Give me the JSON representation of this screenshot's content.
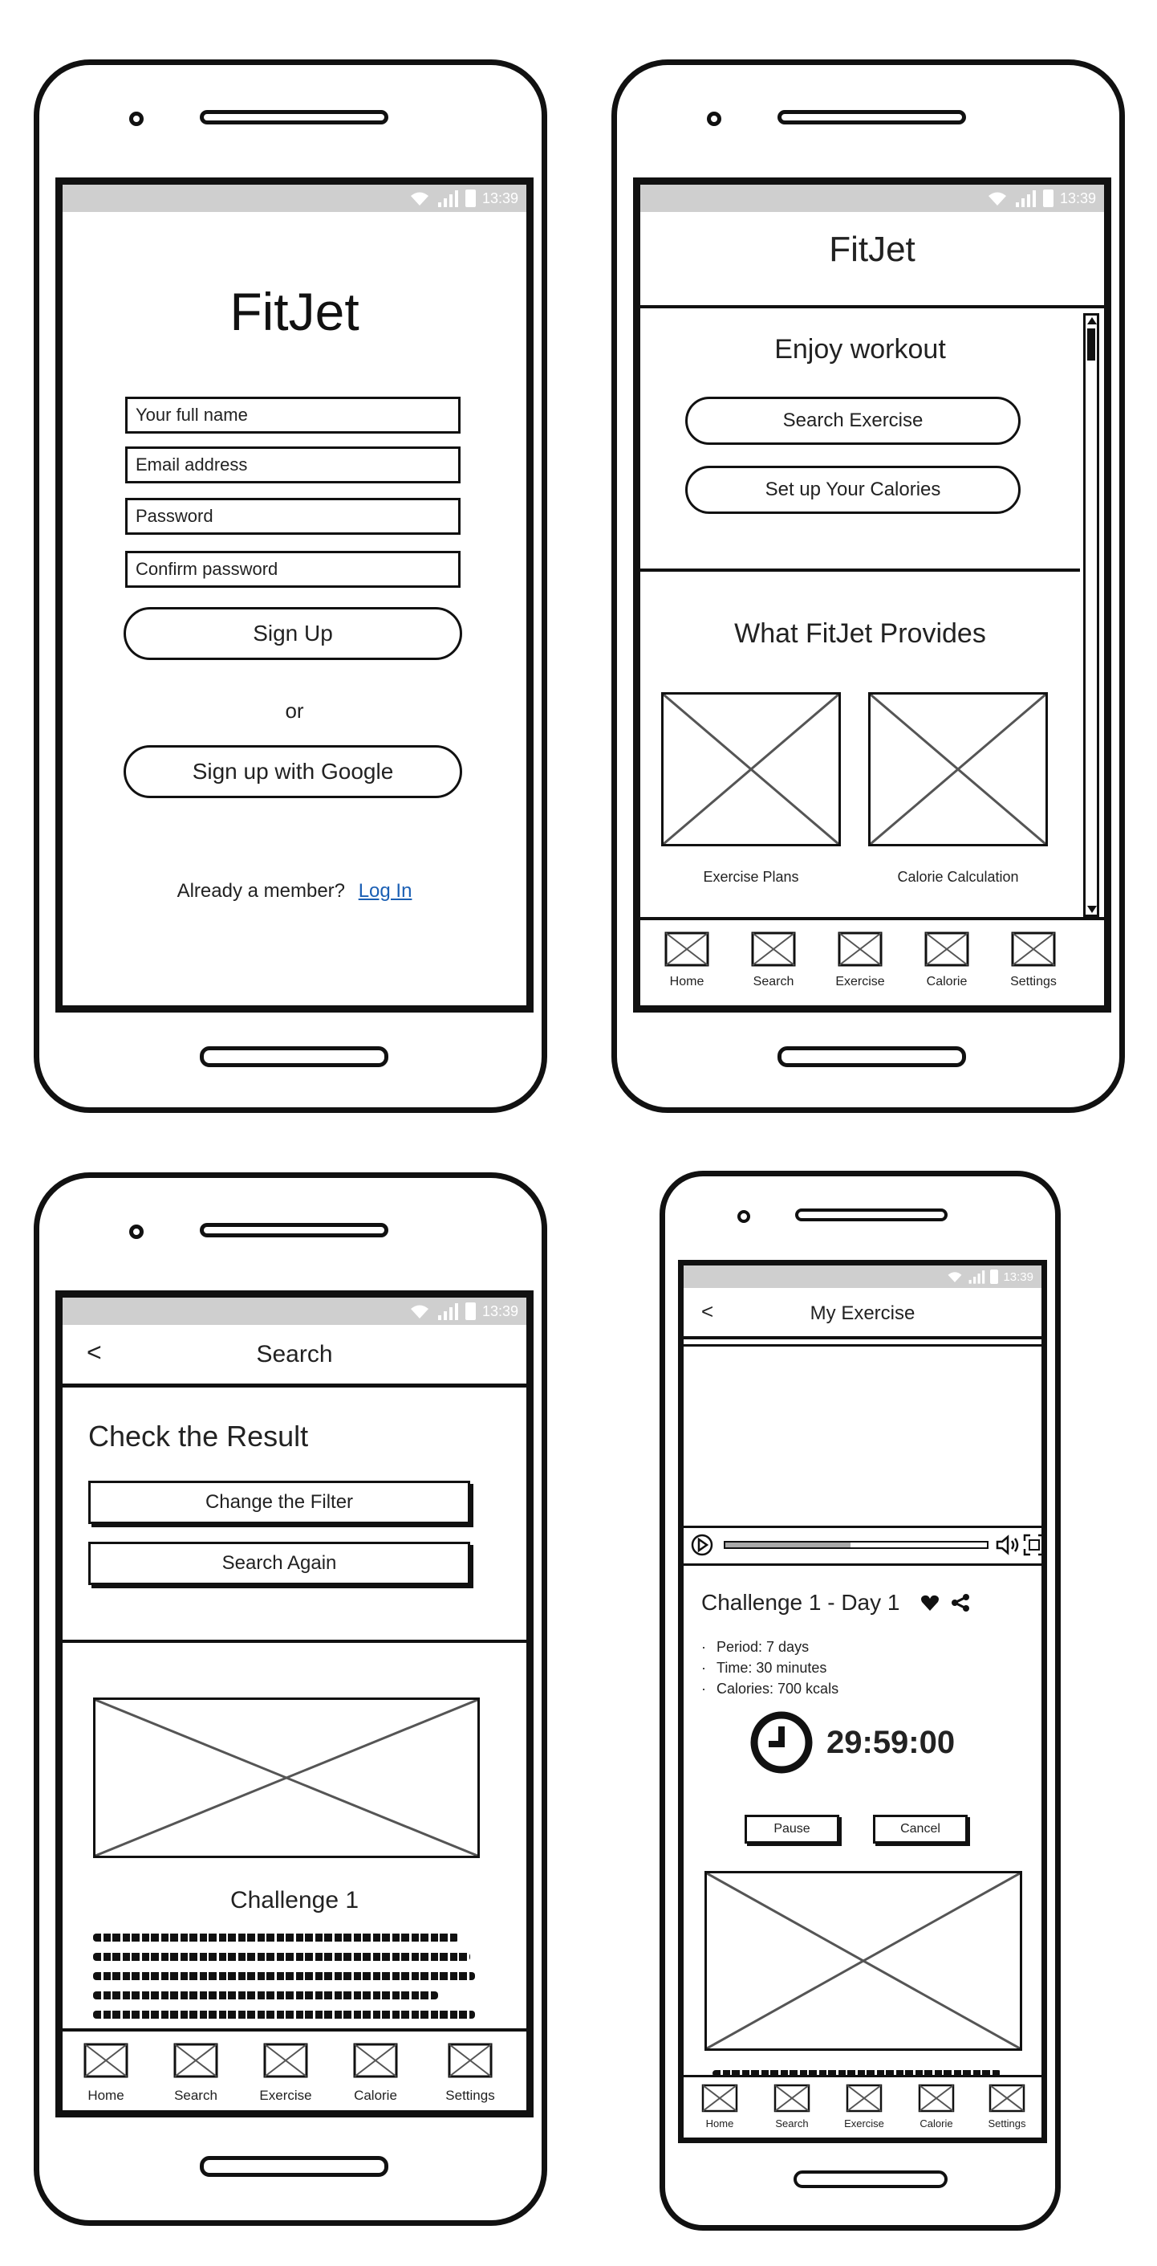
{
  "status": {
    "time": "13:39"
  },
  "signup": {
    "title": "FitJet",
    "fields": {
      "name": "Your full name",
      "email": "Email address",
      "password": "Password",
      "confirm": "Confirm password"
    },
    "signup_label": "Sign Up",
    "or_label": "or",
    "google_label": "Sign up with Google",
    "member_text": "Already a member?",
    "login_link": "Log In"
  },
  "home": {
    "title": "FitJet",
    "enjoy_heading": "Enjoy workout",
    "search_btn": "Search Exercise",
    "calories_btn": "Set up Your Calories",
    "provides_heading": "What FitJet Provides",
    "cards": [
      {
        "label": "Exercise Plans"
      },
      {
        "label": "Calorie Calculation"
      }
    ]
  },
  "nav": {
    "items": [
      {
        "label": "Home"
      },
      {
        "label": "Search"
      },
      {
        "label": "Exercise"
      },
      {
        "label": "Calorie"
      },
      {
        "label": "Settings"
      }
    ]
  },
  "search": {
    "back_glyph": "<",
    "title": "Search",
    "heading": "Check the Result",
    "filter_btn": "Change the Filter",
    "again_btn": "Search Again",
    "result_title": "Challenge 1"
  },
  "exercise": {
    "back_glyph": "<",
    "title": "My Exercise",
    "video_progress": 0.48,
    "challenge_title": "Challenge 1 - Day 1",
    "details": [
      "Period: 7 days",
      "Time: 30 minutes",
      "Calories: 700 kcals"
    ],
    "timer": "29:59:00",
    "pause_btn": "Pause",
    "cancel_btn": "Cancel"
  },
  "icons": {
    "wifi": "wifi-icon",
    "signal": "signal-icon",
    "battery": "battery-icon",
    "play": "play-icon",
    "volume": "volume-icon",
    "fullscreen": "fullscreen-icon",
    "heart": "heart-icon",
    "share": "share-icon",
    "clock": "clock-icon"
  }
}
